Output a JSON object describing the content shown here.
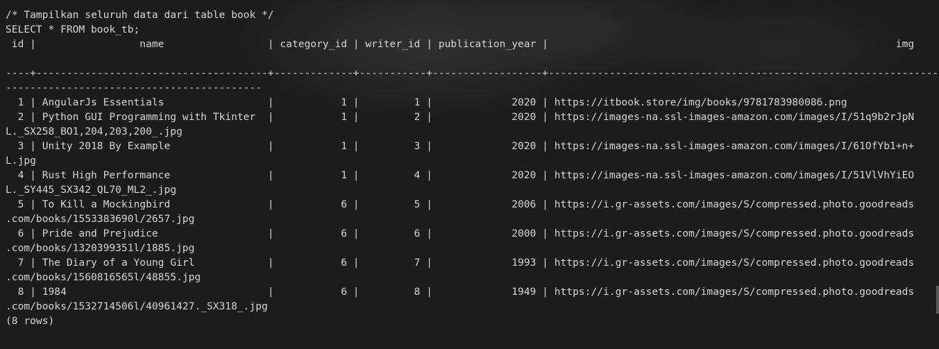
{
  "terminal": {
    "lines": [
      "/* Tampilkan seluruh data dari table book */",
      "SELECT * FROM book_tb;",
      " id |                 name                 | category_id | writer_id | publication_year |                                                         img",
      "",
      "----+--------------------------------------+-------------+-----------+------------------+------------------------------------------------------------------",
      "------------------------------------------",
      "  1 | AngularJs Essentials                 |           1 |         1 |             2020 | https://itbook.store/img/books/9781783980086.png",
      "  2 | Python GUI Programming with Tkinter  |           1 |         2 |             2020 | https://images-na.ssl-images-amazon.com/images/I/51q9b2rJpN",
      "L._SX258_BO1,204,203,200_.jpg",
      "  3 | Unity 2018 By Example                |           1 |         3 |             2020 | https://images-na.ssl-images-amazon.com/images/I/61OfYb1+n+",
      "L.jpg",
      "  4 | Rust High Performance                |           1 |         4 |             2020 | https://images-na.ssl-images-amazon.com/images/I/51VlVhYiEO",
      "L._SY445_SX342_QL70_ML2_.jpg",
      "  5 | To Kill a Mockingbird                |           6 |         5 |             2006 | https://i.gr-assets.com/images/S/compressed.photo.goodreads",
      ".com/books/1553383690l/2657.jpg",
      "  6 | Pride and Prejudice                  |           6 |         6 |             2000 | https://i.gr-assets.com/images/S/compressed.photo.goodreads",
      ".com/books/1320399351l/1885.jpg",
      "  7 | The Diary of a Young Girl            |           6 |         7 |             1993 | https://i.gr-assets.com/images/S/compressed.photo.goodreads",
      ".com/books/1560816565l/48855.jpg",
      "  8 | 1984                                 |           6 |         8 |             1949 | https://i.gr-assets.com/images/S/compressed.photo.goodreads",
      ".com/books/1532714506l/40961427._SX318_.jpg",
      "(8 rows)"
    ]
  }
}
